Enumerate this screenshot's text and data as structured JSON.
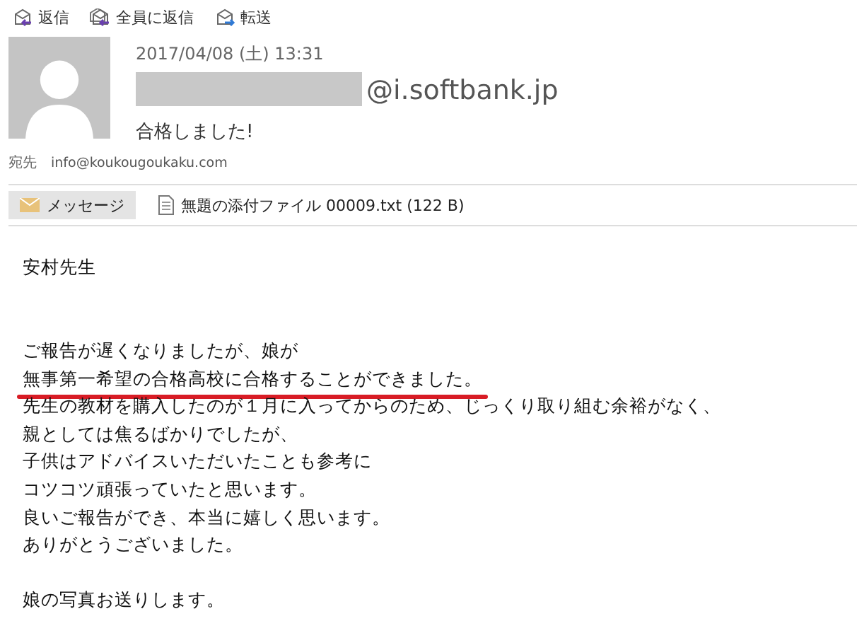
{
  "toolbar": [
    {
      "kind": "reply",
      "label": "返信"
    },
    {
      "kind": "reply_all",
      "label": "全員に返信"
    },
    {
      "kind": "forward",
      "label": "転送"
    }
  ],
  "header": {
    "date": "2017/04/08 (土) 13:31",
    "sender_redacted": true,
    "sender": "@i.softbank.jp",
    "subject": "合格しました!",
    "to_label": "宛先",
    "to": "info@koukougoukaku.com"
  },
  "attachments": [
    {
      "kind": "message",
      "label": "メッセージ",
      "selected": true
    },
    {
      "kind": "file",
      "label": "無題の添付ファイル 00009.txt (122 B)",
      "selected": false
    }
  ],
  "body": [
    {
      "kind": "text",
      "text": "安村先生",
      "underlined": false
    },
    {
      "kind": "blank"
    },
    {
      "kind": "blank"
    },
    {
      "kind": "text",
      "text": "ご報告が遅くなりましたが、娘が",
      "underlined": false
    },
    {
      "kind": "text",
      "text": "無事第一希望の合格高校に合格することができました。",
      "underlined": true
    },
    {
      "kind": "text",
      "text": "先生の教材を購入したのが１月に入ってからのため、じっくり取り組む余裕がなく、",
      "underlined": false
    },
    {
      "kind": "text",
      "text": "親としては焦るばかりでしたが、",
      "underlined": false
    },
    {
      "kind": "text",
      "text": "子供はアドバイスいただいたことも参考に",
      "underlined": false
    },
    {
      "kind": "text",
      "text": "コツコツ頑張っていたと思います。",
      "underlined": false
    },
    {
      "kind": "text",
      "text": "良いご報告ができ、本当に嬉しく思います。",
      "underlined": false
    },
    {
      "kind": "text",
      "text": "ありがとうございました。",
      "underlined": false
    },
    {
      "kind": "blank"
    },
    {
      "kind": "text",
      "text": "娘の写真お送りします。",
      "underlined": false
    }
  ]
}
